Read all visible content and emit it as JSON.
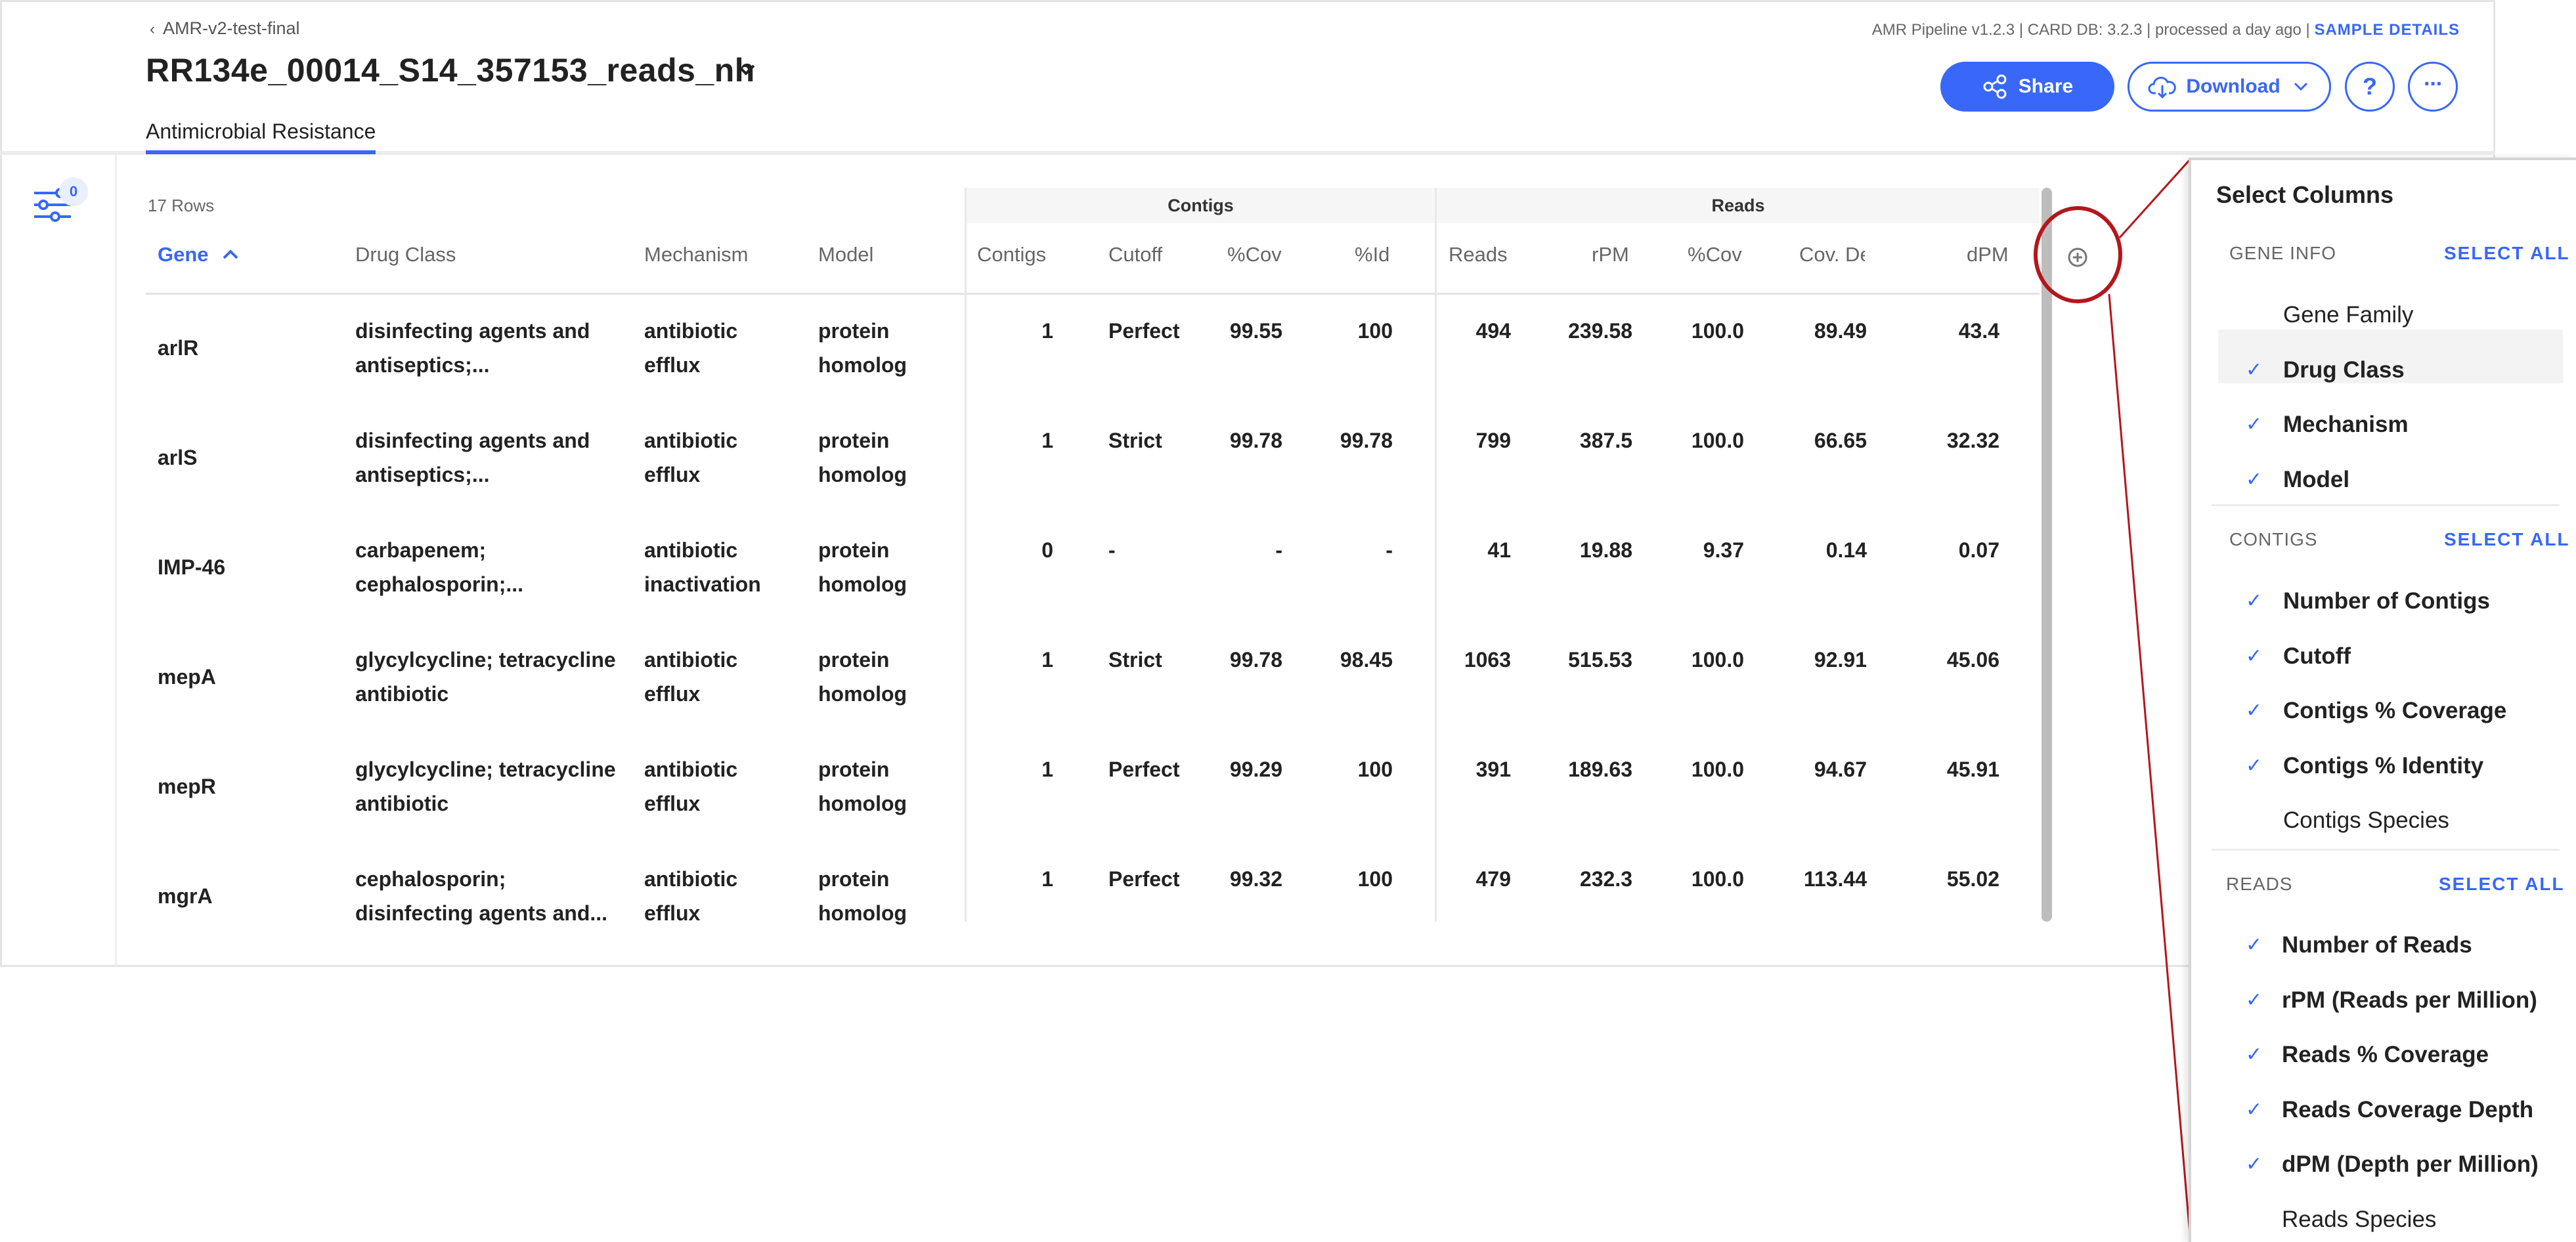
{
  "header": {
    "back_label": "AMR-v2-test-final",
    "sample_title": "RR134e_00014_S14_357153_reads_nh",
    "tab_label": "Antimicrobial Resistance",
    "meta_text": "AMR Pipeline v1.2.3 | CARD DB: 3.2.3 | processed a day ago |",
    "sample_details_label": "SAMPLE DETAILS",
    "share_label": "Share",
    "download_label": "Download",
    "help_label": "?",
    "more_label": "···"
  },
  "filters": {
    "badge_count": "0"
  },
  "table": {
    "rows_count": "17 Rows",
    "groups": {
      "contigs": "Contigs",
      "reads": "Reads"
    },
    "columns": {
      "gene": "Gene",
      "drug_class": "Drug Class",
      "mechanism": "Mechanism",
      "model": "Model",
      "contigs": "Contigs",
      "cutoff": "Cutoff",
      "contig_cov": "%Cov",
      "contig_id": "%Id",
      "reads": "Reads",
      "rpm": "rPM",
      "reads_cov": "%Cov",
      "cov_depth": "Cov. De",
      "dpm": "dPM"
    },
    "rows": [
      {
        "gene": "arlR",
        "drug1": "disinfecting agents and",
        "drug2": "antiseptics;...",
        "mech1": "antibiotic",
        "mech2": "efflux",
        "model1": "protein",
        "model2": "homolog",
        "contigs": "1",
        "cutoff": "Perfect",
        "ccov": "99.55",
        "cid": "100",
        "reads": "494",
        "rpm": "239.58",
        "rcov": "100.0",
        "depth": "89.49",
        "dpm": "43.4"
      },
      {
        "gene": "arlS",
        "drug1": "disinfecting agents and",
        "drug2": "antiseptics;...",
        "mech1": "antibiotic",
        "mech2": "efflux",
        "model1": "protein",
        "model2": "homolog",
        "contigs": "1",
        "cutoff": "Strict",
        "ccov": "99.78",
        "cid": "99.78",
        "reads": "799",
        "rpm": "387.5",
        "rcov": "100.0",
        "depth": "66.65",
        "dpm": "32.32"
      },
      {
        "gene": "IMP-46",
        "drug1": "carbapenem;",
        "drug2": "cephalosporin;...",
        "mech1": "antibiotic",
        "mech2": "inactivation",
        "model1": "protein",
        "model2": "homolog",
        "contigs": "0",
        "cutoff": "-",
        "ccov": "-",
        "cid": "-",
        "reads": "41",
        "rpm": "19.88",
        "rcov": "9.37",
        "depth": "0.14",
        "dpm": "0.07"
      },
      {
        "gene": "mepA",
        "drug1": "glycylcycline; tetracycline",
        "drug2": "antibiotic",
        "mech1": "antibiotic",
        "mech2": "efflux",
        "model1": "protein",
        "model2": "homolog",
        "contigs": "1",
        "cutoff": "Strict",
        "ccov": "99.78",
        "cid": "98.45",
        "reads": "1063",
        "rpm": "515.53",
        "rcov": "100.0",
        "depth": "92.91",
        "dpm": "45.06"
      },
      {
        "gene": "mepR",
        "drug1": "glycylcycline; tetracycline",
        "drug2": "antibiotic",
        "mech1": "antibiotic",
        "mech2": "efflux",
        "model1": "protein",
        "model2": "homolog",
        "contigs": "1",
        "cutoff": "Perfect",
        "ccov": "99.29",
        "cid": "100",
        "reads": "391",
        "rpm": "189.63",
        "rcov": "100.0",
        "depth": "94.67",
        "dpm": "45.91"
      },
      {
        "gene": "mgrA",
        "drug1": "cephalosporin;",
        "drug2": "disinfecting agents and...",
        "mech1": "antibiotic",
        "mech2": "efflux",
        "model1": "protein",
        "model2": "homolog",
        "contigs": "1",
        "cutoff": "Perfect",
        "ccov": "99.32",
        "cid": "100",
        "reads": "479",
        "rpm": "232.3",
        "rcov": "100.0",
        "depth": "113.44",
        "dpm": "55.02"
      }
    ]
  },
  "column_panel": {
    "title": "Select Columns",
    "sections": [
      {
        "label": "GENE INFO",
        "select_all": "SELECT ALL",
        "options": [
          {
            "label": "Gene Family",
            "checked": false
          },
          {
            "label": "Drug Class",
            "checked": true
          },
          {
            "label": "Mechanism",
            "checked": true
          },
          {
            "label": "Model",
            "checked": true
          }
        ]
      },
      {
        "label": "CONTIGS",
        "select_all": "SELECT ALL",
        "options": [
          {
            "label": "Number of Contigs",
            "checked": true
          },
          {
            "label": "Cutoff",
            "checked": true
          },
          {
            "label": "Contigs % Coverage",
            "checked": true
          },
          {
            "label": "Contigs % Identity",
            "checked": true
          },
          {
            "label": "Contigs Species",
            "checked": false
          }
        ]
      },
      {
        "label": "READS",
        "select_all": "SELECT ALL",
        "options": [
          {
            "label": "Number of Reads",
            "checked": true
          },
          {
            "label": "rPM (Reads per Million)",
            "checked": true
          },
          {
            "label": "Reads % Coverage",
            "checked": true
          },
          {
            "label": "Reads Coverage Depth",
            "checked": true
          },
          {
            "label": "dPM (Depth per Million)",
            "checked": true
          },
          {
            "label": "Reads Species",
            "checked": false
          }
        ]
      }
    ],
    "check_mark": "✓"
  },
  "colors": {
    "accent": "#3867fa",
    "highlight": "#b5161c"
  }
}
